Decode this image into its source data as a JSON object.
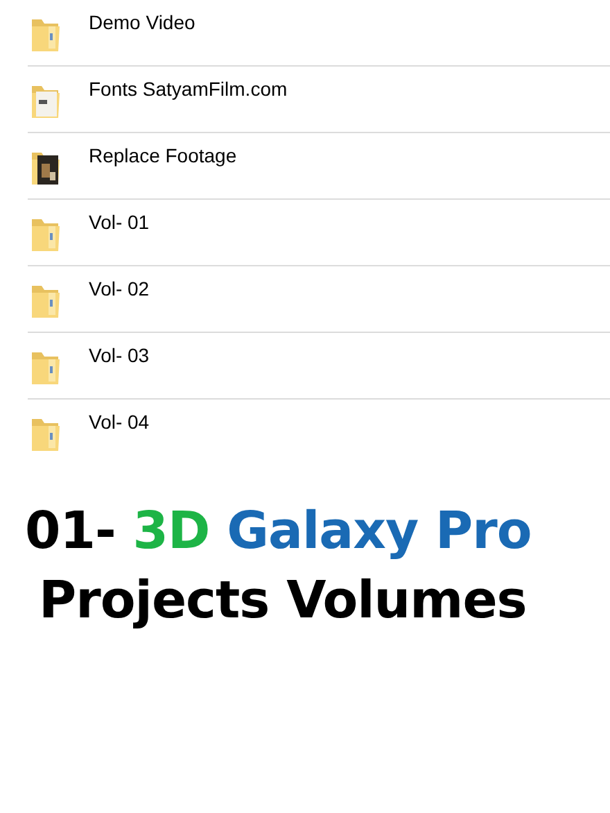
{
  "folders": [
    {
      "name": "Demo Video",
      "kind": "folder"
    },
    {
      "name": "Fonts SatyamFilm.com",
      "kind": "document"
    },
    {
      "name": "Replace Footage",
      "kind": "photo"
    },
    {
      "name": "Vol- 01",
      "kind": "folder"
    },
    {
      "name": "Vol- 02",
      "kind": "folder"
    },
    {
      "name": "Vol- 03",
      "kind": "folder"
    },
    {
      "name": "Vol- 04",
      "kind": "folder"
    }
  ],
  "headline": [
    [
      {
        "text": "01-",
        "color": "#000000"
      },
      {
        "text": "3D",
        "color": "#1db446"
      },
      {
        "text": "Galaxy Pro",
        "color": "#1a6ab4"
      }
    ],
    [
      {
        "text": "Projects Volumes",
        "color": "#000000"
      }
    ]
  ]
}
